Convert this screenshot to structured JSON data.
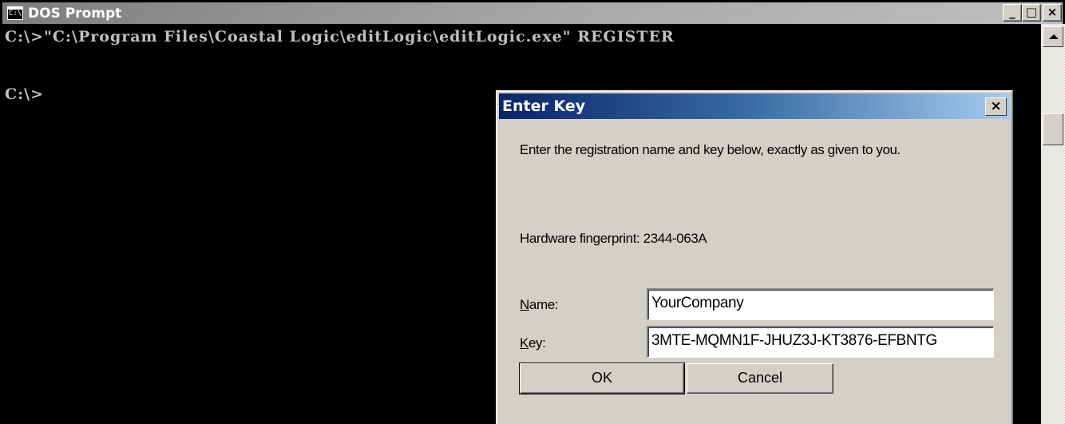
{
  "dos_window": {
    "title": "DOS Prompt",
    "icon_text": "C:\\",
    "controls": {
      "minimize": "_",
      "maximize": "□",
      "close": "×"
    },
    "console_lines": [
      "C:\\>\"C:\\Program Files\\Coastal Logic\\editLogic\\editLogic.exe\" REGISTER",
      "C:\\>"
    ]
  },
  "dialog": {
    "title": "Enter Key",
    "close_glyph": "×",
    "instruction": "Enter the registration name and key below, exactly as given to you.",
    "fingerprint": "Hardware fingerprint: 2344-063A",
    "name_label_first": "N",
    "name_label_rest": "ame:",
    "name_value": "YourCompany",
    "key_label_first": "K",
    "key_label_rest": "ey:",
    "key_value": "3MTE-MQMN1F-JHUZ3J-KT3876-EFBNTG",
    "ok_label": "OK",
    "cancel_label": "Cancel"
  }
}
